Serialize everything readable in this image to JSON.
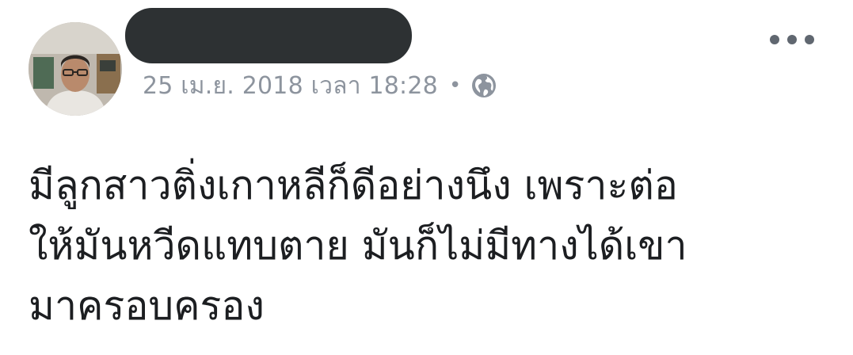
{
  "post": {
    "author_name_redacted": true,
    "avatar_icon": "profile-photo",
    "timestamp": "25 เม.ย. 2018 เวลา 18:28",
    "separator": "•",
    "privacy_icon": "globe-icon",
    "more_icon": "more-options-icon",
    "text_lines": [
      "มีลูกสาวติ่งเกาหลีก็ดีอย่างนึง เพราะต่อ",
      "ให้มันหวีดแทบตาย มันก็ไม่มีทางได้เขา",
      "มาครอบครอง"
    ]
  },
  "colors": {
    "text_primary": "#1c1e21",
    "text_secondary": "#8d949e",
    "redaction": "#2d3133",
    "icon": "#606770"
  }
}
